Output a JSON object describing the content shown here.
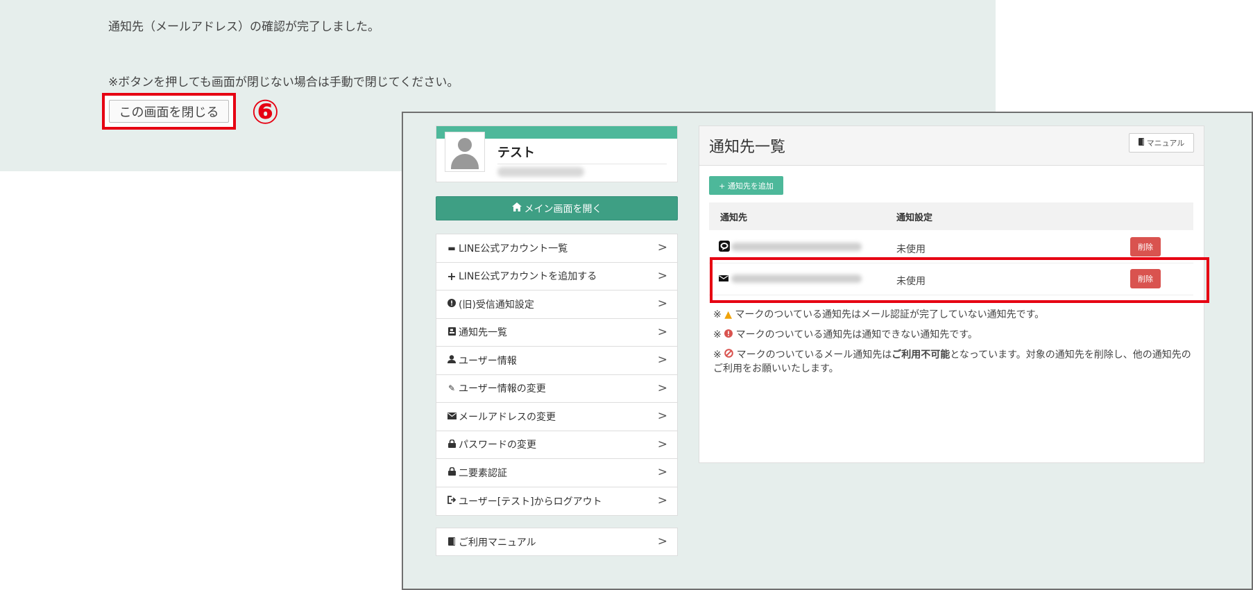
{
  "confirm_page": {
    "message": "通知先（メールアドレス）の確認が完了しました。",
    "note": "※ボタンを押しても画面が閉じない場合は手動で閉じてください。",
    "close_button": "この画面を閉じる",
    "step_marker": "⑥"
  },
  "profile": {
    "name": "テスト"
  },
  "main_button": "メイン画面を開く",
  "menu": {
    "items": [
      {
        "label": "LINE公式アカウント一覧",
        "icon": "comment-icon"
      },
      {
        "label": "LINE公式アカウントを追加する",
        "icon": "plus-icon"
      },
      {
        "label": "(旧)受信通知設定",
        "icon": "exclamation-circle-icon"
      },
      {
        "label": "通知先一覧",
        "icon": "contact-card-icon"
      },
      {
        "label": "ユーザー情報",
        "icon": "user-icon"
      },
      {
        "label": "ユーザー情報の変更",
        "icon": "pencil-icon"
      },
      {
        "label": "メールアドレスの変更",
        "icon": "envelope-icon"
      },
      {
        "label": "パスワードの変更",
        "icon": "lock-icon"
      },
      {
        "label": "二要素認証",
        "icon": "lock-icon"
      },
      {
        "label": "ユーザー[テスト]からログアウト",
        "icon": "logout-icon"
      }
    ],
    "manual": "ご利用マニュアル"
  },
  "panel": {
    "title": "通知先一覧",
    "manual_button": "マニュアル",
    "add_button": "+ 通知先を追加",
    "columns": [
      "通知先",
      "通知設定"
    ],
    "rows": [
      {
        "type_icon": "line-icon",
        "status": "未使用",
        "delete": "削除"
      },
      {
        "type_icon": "envelope-icon",
        "status": "未使用",
        "delete": "削除"
      }
    ],
    "notes": {
      "n1_prefix": "※",
      "n1_text": "マークのついている通知先はメール認証が完了していない通知先です。",
      "n2_prefix": "※",
      "n2_text": "マークのついている通知先は通知できない通知先です。",
      "n3_prefix": "※",
      "n3_text_a": "マークのついているメール通知先は",
      "n3_bold": "ご利用不可能",
      "n3_text_b": "となっています。対象の通知先を削除し、他の通知先のご利用をお願いいたします。"
    }
  },
  "colors": {
    "accent_green": "#4db89a",
    "button_green": "#3e9f84",
    "danger_red": "#d9534f",
    "highlight_red": "#e60012"
  }
}
